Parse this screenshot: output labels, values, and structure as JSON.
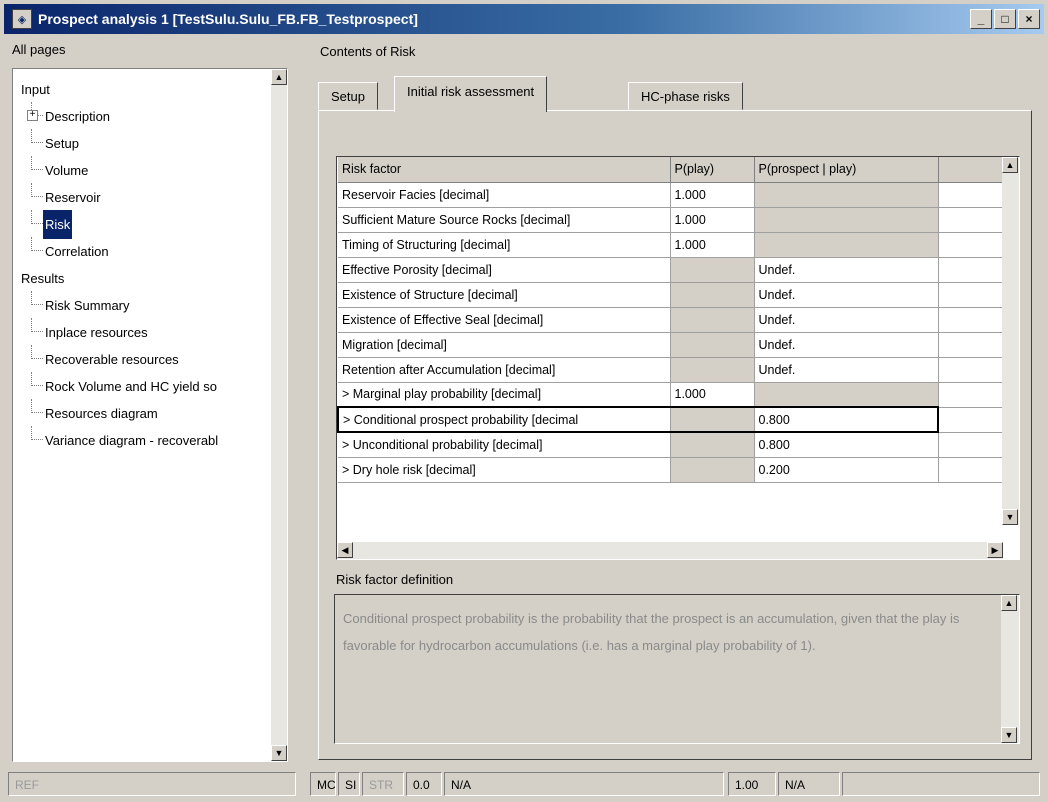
{
  "window": {
    "title": "Prospect analysis 1 [TestSulu.Sulu_FB.FB_Testprospect]",
    "minimize": "_",
    "maximize": "□",
    "close": "×"
  },
  "left": {
    "header": "All pages",
    "tree": [
      {
        "label": "Input",
        "level": 0
      },
      {
        "label": "Description",
        "level": 1,
        "expander": "+"
      },
      {
        "label": "Setup",
        "level": 1
      },
      {
        "label": "Volume",
        "level": 1
      },
      {
        "label": "Reservoir",
        "level": 1
      },
      {
        "label": "Risk",
        "level": 1,
        "selected": true
      },
      {
        "label": "Correlation",
        "level": 1
      },
      {
        "label": "Results",
        "level": 0
      },
      {
        "label": "Risk Summary",
        "level": 1
      },
      {
        "label": "Inplace resources",
        "level": 1
      },
      {
        "label": "Recoverable resources",
        "level": 1
      },
      {
        "label": "Rock Volume and HC yield so",
        "level": 1
      },
      {
        "label": "Resources diagram",
        "level": 1
      },
      {
        "label": "Variance diagram - recoverabl",
        "level": 1
      }
    ]
  },
  "right": {
    "title": "Contents of Risk",
    "tabs": [
      "Setup",
      "Initial risk assessment",
      "HC-phase risks"
    ],
    "active_tab": 1,
    "grid": {
      "columns": [
        "Risk factor",
        "P(play)",
        "P(prospect | play)"
      ],
      "rows": [
        [
          "Reservoir Facies [decimal]",
          "1.000",
          ""
        ],
        [
          "Sufficient Mature Source Rocks [decimal]",
          "1.000",
          ""
        ],
        [
          "Timing of Structuring [decimal]",
          "1.000",
          ""
        ],
        [
          "Effective Porosity [decimal]",
          "",
          "Undef."
        ],
        [
          "Existence of Structure [decimal]",
          "",
          "Undef."
        ],
        [
          "Existence of Effective Seal [decimal]",
          "",
          "Undef."
        ],
        [
          "Migration [decimal]",
          "",
          "Undef."
        ],
        [
          "Retention after Accumulation [decimal]",
          "",
          "Undef."
        ],
        [
          "> Marginal play probability [decimal]",
          "1.000",
          ""
        ],
        [
          "> Conditional prospect probability [decimal",
          "",
          "0.800"
        ],
        [
          "> Unconditional probability [decimal]",
          "",
          "0.800"
        ],
        [
          "> Dry hole risk [decimal]",
          "",
          "0.200"
        ]
      ]
    },
    "definition_label": "Risk factor definition",
    "definition_text": "Conditional prospect probability is the probability that the prospect is an accumulation, given that the play is favorable for hydrocarbon accumulations (i.e. has a marginal play probability of 1)."
  },
  "status": {
    "ref": "REF",
    "mc": "MC",
    "si": "SI",
    "str": "STR",
    "val": "0.0",
    "na1": "N/A",
    "ver": "1.00",
    "na2": "N/A"
  },
  "colors": {
    "title_start": "#0a246a",
    "selection": "#0a246a",
    "face": "#d4d0c8"
  }
}
